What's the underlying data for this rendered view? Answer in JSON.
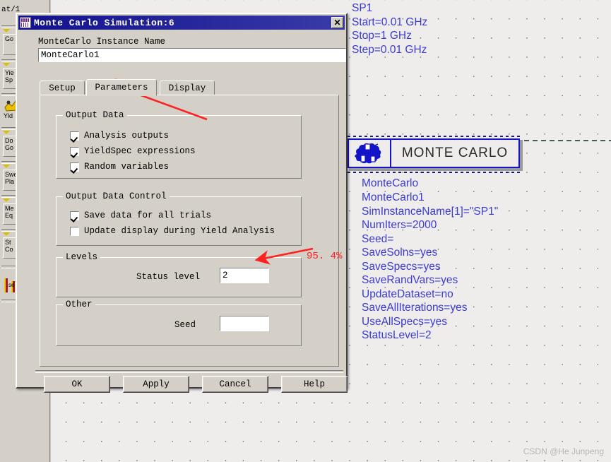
{
  "dialog": {
    "title": "Monte Carlo Simulation:6",
    "title_icon": "monte-carlo-icon",
    "close_label": "✕",
    "instance_name_label": "MonteCarlo Instance Name",
    "instance_name_value": "MonteCarlo1",
    "tabs": [
      {
        "label": "Setup",
        "active": false
      },
      {
        "label": "Parameters",
        "active": true
      },
      {
        "label": "Display",
        "active": false
      }
    ],
    "groups": {
      "output_data": {
        "title": "Output Data",
        "items": [
          {
            "label": "Analysis outputs",
            "checked": true
          },
          {
            "label": "YieldSpec expressions",
            "checked": true
          },
          {
            "label": "Random variables",
            "checked": true
          }
        ]
      },
      "output_data_control": {
        "title": "Output Data Control",
        "items": [
          {
            "label": "Save data for all trials",
            "checked": true
          },
          {
            "label": "Update display during Yield Analysis",
            "checked": false
          }
        ]
      },
      "levels": {
        "title": "Levels",
        "status_level_label": "Status level",
        "status_level_value": "2"
      },
      "other": {
        "title": "Other",
        "seed_label": "Seed",
        "seed_value": ""
      }
    },
    "buttons": [
      {
        "label": "OK"
      },
      {
        "label": "Apply"
      },
      {
        "label": "Cancel"
      },
      {
        "label": "Help"
      }
    ]
  },
  "schematic": {
    "sp_block": "SP1\nStart=0.01 GHz\nStop=1 GHz\nStep=0.01 GHz",
    "component": {
      "label": "MONTE CARLO",
      "icon": "monte-carlo-component-icon"
    },
    "mc_type": "MonteCarlo",
    "mc_params": "MonteCarlo1\nSimInstanceName[1]=\"SP1\"\nNumIters=2000\nSeed=\nSaveSolns=yes\nSaveSpecs=yes\nSaveRandVars=yes\nUpdateDataset=no\nSaveAllIterations=yes\nUseAllSpecs=yes\nStatusLevel=2"
  },
  "palette": {
    "top_crop_label": "at/1",
    "items": [
      {
        "label": "Go",
        "icon": "optim-goal-icon"
      },
      {
        "label": "Yie\nSp",
        "icon": "yield-spec-icon"
      },
      {
        "label": "Yld",
        "icon": "yield-opt-icon"
      },
      {
        "label": "Do\nGo",
        "icon": "doe-goal-icon"
      },
      {
        "label": "Swe\nPla",
        "icon": "sweep-plan-icon"
      },
      {
        "label": "Me\nEq",
        "icon": "meas-eqn-icon"
      },
      {
        "label": "St\nCo",
        "icon": "stat-corr-icon"
      },
      {
        "label": "se",
        "icon": "sense-icon"
      }
    ]
  },
  "annotations": {
    "arrow_tab": "arrow-to-parameters-tab",
    "arrow_status": "arrow-to-status-level",
    "percent_label": "95. 4%"
  },
  "watermark": "CSDN @He Junpeng",
  "colors": {
    "dialog_face": "#d4d0c8",
    "titlebar": "#11118c",
    "schematic_text": "#3b3bd0",
    "schematic_text_light": "#6ea8f0",
    "annotation_red": "#ff2020",
    "component_border": "#1414c8"
  }
}
